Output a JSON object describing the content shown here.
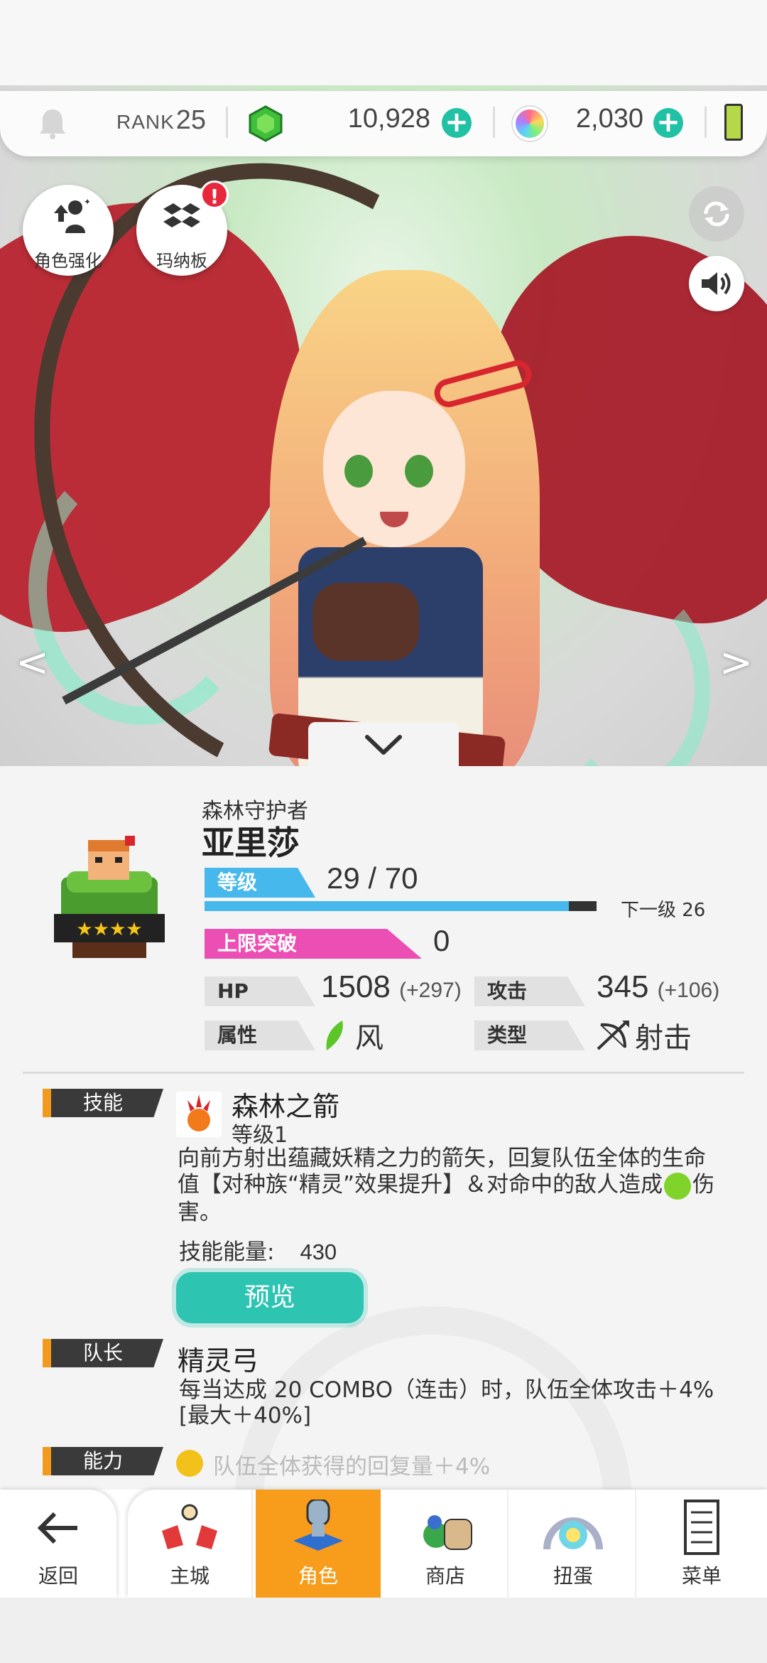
{
  "topbar": {
    "rank_label": "RANK",
    "rank_value": "25",
    "gem_amount": "10,928",
    "orb_amount": "2,030",
    "icons": [
      "bell-icon",
      "green-gem-icon",
      "plus-icon",
      "rainbow-orb-icon",
      "battery-icon"
    ]
  },
  "hero_buttons": {
    "enhance_label": "角色强化",
    "board_label": "玛纳板",
    "board_badge": "!"
  },
  "character": {
    "subtitle": "森林守护者",
    "name": "亚里莎",
    "level_label": "等级",
    "level_value": "29 / 70",
    "exp_progress": 0.93,
    "next_level_label": "下一级 26",
    "limit_label": "上限突破",
    "limit_value": "0",
    "hp_label": "HP",
    "hp_value": "1508",
    "hp_bonus": "(+297)",
    "atk_label": "攻击",
    "atk_value": "345",
    "atk_bonus": "(+106)",
    "attr_label": "属性",
    "attr_value": "风",
    "type_label": "类型",
    "type_value": "射击",
    "stars": 4
  },
  "skill": {
    "tag": "技能",
    "name": "森林之箭",
    "level": "等级1",
    "desc_part1": "向前方射出蕴藏妖精之力的箭矢，回复队伍全体的生命值【对种族“精灵”效果提升】＆对命中的敌人造成",
    "desc_part2": "伤害。",
    "energy_label": "技能能量:",
    "energy_value": "430",
    "preview_button": "预览"
  },
  "leader": {
    "tag": "队长",
    "name": "精灵弓",
    "desc": "每当达成 20 COMBO（连击）时，队伍全体攻击＋4%[最大＋40%]"
  },
  "ability": {
    "tag": "能力",
    "text": "队伍全体获得的回复量＋4%"
  },
  "tabs": {
    "back": "返回",
    "town": "主城",
    "character": "角色",
    "shop": "商店",
    "gacha": "扭蛋",
    "menu": "菜单"
  },
  "colors": {
    "accent_teal": "#2ec4b2",
    "level_blue": "#46b8ec",
    "limit_pink": "#ec4fb4",
    "active_tab": "#f89c1c"
  }
}
